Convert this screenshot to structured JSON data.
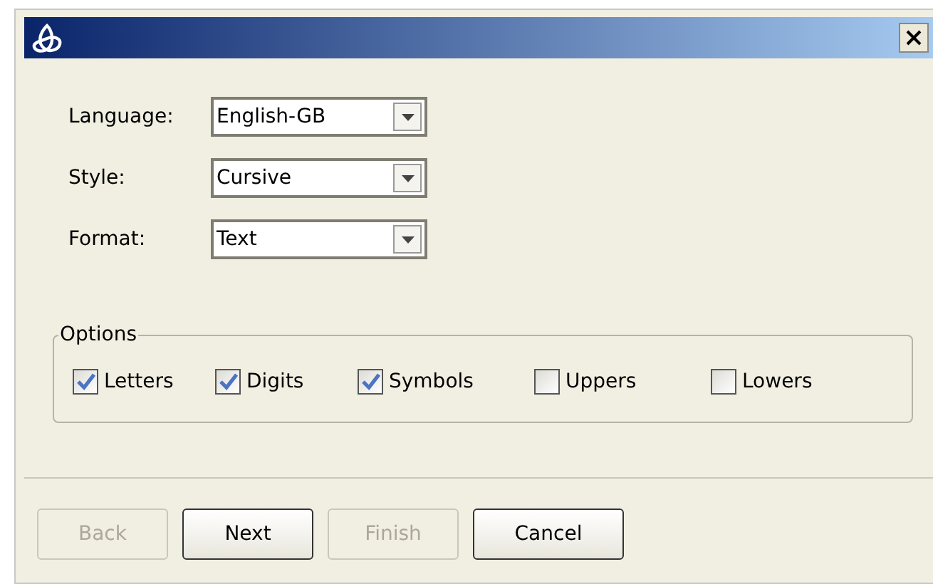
{
  "fields": [
    {
      "label": "Language:",
      "value": "English-GB"
    },
    {
      "label": "Style:",
      "value": "Cursive"
    },
    {
      "label": "Format:",
      "value": "Text"
    }
  ],
  "options": {
    "title": "Options",
    "items": [
      {
        "label": "Letters",
        "checked": true
      },
      {
        "label": "Digits",
        "checked": true
      },
      {
        "label": "Symbols",
        "checked": true
      },
      {
        "label": "Uppers",
        "checked": false
      },
      {
        "label": "Lowers",
        "checked": false
      }
    ]
  },
  "buttons": [
    {
      "label": "Back",
      "disabled": true
    },
    {
      "label": "Next",
      "disabled": false
    },
    {
      "label": "Finish",
      "disabled": true
    },
    {
      "label": "Cancel",
      "disabled": false
    }
  ]
}
